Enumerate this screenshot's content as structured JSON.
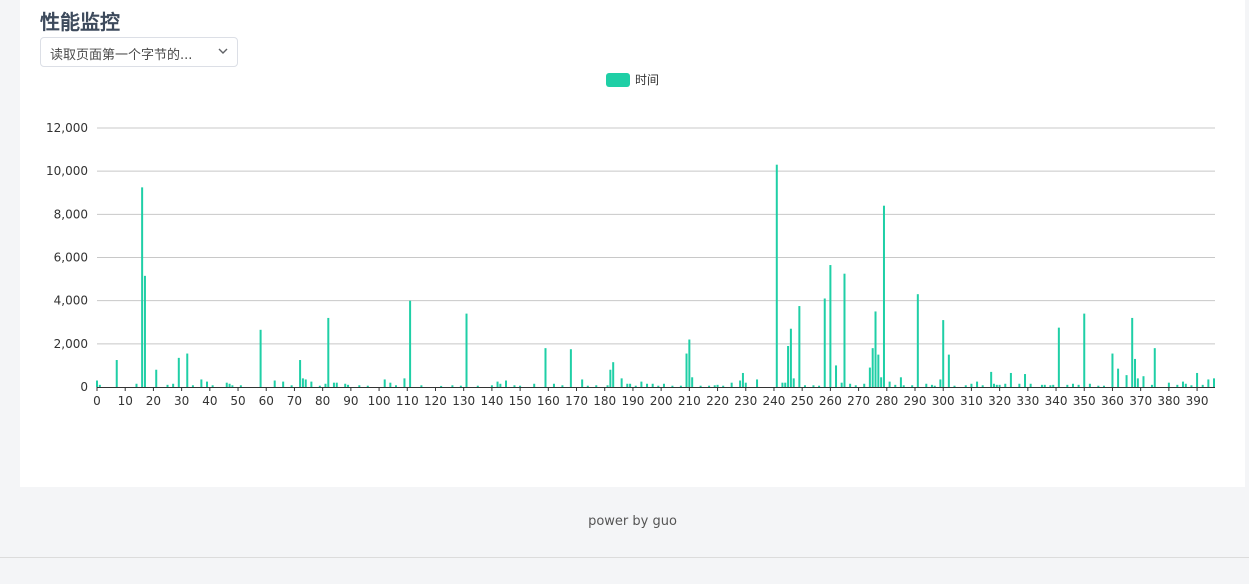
{
  "page": {
    "title": "性能监控",
    "metric_select": "读取页面第一个字节的...",
    "footer": "power by guo"
  },
  "colors": {
    "bar": "#1fcfa6",
    "grid": "#c8c8c8",
    "text": "#333333"
  },
  "icons": {
    "select_arrow": "chevron-down-icon"
  },
  "chart_data": {
    "type": "bar",
    "legend": [
      "时间"
    ],
    "legend_position": "top-center",
    "grid": true,
    "ylim": [
      0,
      12000
    ],
    "yticks": [
      "0",
      "2,000",
      "4,000",
      "6,000",
      "8,000",
      "10,000",
      "12,000"
    ],
    "ytick_values": [
      0,
      2000,
      4000,
      6000,
      8000,
      10000,
      12000
    ],
    "xticks": [
      "0",
      "10",
      "20",
      "30",
      "40",
      "50",
      "60",
      "70",
      "80",
      "90",
      "100",
      "110",
      "120",
      "130",
      "140",
      "150",
      "160",
      "170",
      "180",
      "190",
      "200",
      "210",
      "220",
      "230",
      "240",
      "250",
      "260",
      "270",
      "280",
      "290",
      "300",
      "310",
      "320",
      "330",
      "340",
      "350",
      "360",
      "370",
      "380",
      "390"
    ],
    "xtick_values": [
      0,
      10,
      20,
      30,
      40,
      50,
      60,
      70,
      80,
      90,
      100,
      110,
      120,
      130,
      140,
      150,
      160,
      170,
      180,
      190,
      200,
      210,
      220,
      230,
      240,
      250,
      260,
      270,
      280,
      290,
      300,
      310,
      320,
      330,
      340,
      350,
      360,
      370,
      380,
      390
    ],
    "x_count": 397,
    "series": [
      {
        "name": "时间",
        "points": [
          [
            0,
            300
          ],
          [
            1,
            100
          ],
          [
            7,
            1250
          ],
          [
            14,
            150
          ],
          [
            16,
            9250
          ],
          [
            17,
            5150
          ],
          [
            21,
            800
          ],
          [
            25,
            100
          ],
          [
            27,
            150
          ],
          [
            29,
            1350
          ],
          [
            32,
            1550
          ],
          [
            34,
            80
          ],
          [
            37,
            350
          ],
          [
            39,
            250
          ],
          [
            41,
            80
          ],
          [
            46,
            200
          ],
          [
            47,
            150
          ],
          [
            48,
            80
          ],
          [
            51,
            80
          ],
          [
            58,
            2650
          ],
          [
            63,
            300
          ],
          [
            66,
            250
          ],
          [
            69,
            80
          ],
          [
            72,
            1250
          ],
          [
            73,
            400
          ],
          [
            74,
            350
          ],
          [
            76,
            250
          ],
          [
            79,
            60
          ],
          [
            81,
            150
          ],
          [
            82,
            3200
          ],
          [
            84,
            200
          ],
          [
            85,
            200
          ],
          [
            88,
            150
          ],
          [
            89,
            100
          ],
          [
            93,
            80
          ],
          [
            96,
            60
          ],
          [
            102,
            350
          ],
          [
            104,
            200
          ],
          [
            106,
            80
          ],
          [
            109,
            400
          ],
          [
            111,
            4000
          ],
          [
            115,
            80
          ],
          [
            122,
            50
          ],
          [
            126,
            80
          ],
          [
            129,
            60
          ],
          [
            131,
            3400
          ],
          [
            135,
            60
          ],
          [
            140,
            80
          ],
          [
            142,
            250
          ],
          [
            143,
            150
          ],
          [
            145,
            300
          ],
          [
            148,
            80
          ],
          [
            150,
            60
          ],
          [
            155,
            150
          ],
          [
            159,
            1800
          ],
          [
            162,
            150
          ],
          [
            165,
            80
          ],
          [
            168,
            1750
          ],
          [
            172,
            350
          ],
          [
            174,
            60
          ],
          [
            177,
            80
          ],
          [
            181,
            80
          ],
          [
            182,
            800
          ],
          [
            183,
            1150
          ],
          [
            186,
            400
          ],
          [
            188,
            150
          ],
          [
            189,
            150
          ],
          [
            191,
            60
          ],
          [
            193,
            250
          ],
          [
            195,
            150
          ],
          [
            197,
            150
          ],
          [
            199,
            60
          ],
          [
            201,
            150
          ],
          [
            204,
            60
          ],
          [
            207,
            60
          ],
          [
            209,
            1550
          ],
          [
            210,
            2200
          ],
          [
            211,
            450
          ],
          [
            214,
            60
          ],
          [
            217,
            60
          ],
          [
            219,
            80
          ],
          [
            220,
            100
          ],
          [
            222,
            60
          ],
          [
            225,
            200
          ],
          [
            228,
            300
          ],
          [
            229,
            650
          ],
          [
            230,
            200
          ],
          [
            234,
            350
          ],
          [
            241,
            10300
          ],
          [
            243,
            200
          ],
          [
            244,
            200
          ],
          [
            245,
            1900
          ],
          [
            246,
            2700
          ],
          [
            247,
            400
          ],
          [
            249,
            3750
          ],
          [
            251,
            80
          ],
          [
            254,
            80
          ],
          [
            256,
            60
          ],
          [
            258,
            4100
          ],
          [
            260,
            5650
          ],
          [
            262,
            1000
          ],
          [
            264,
            200
          ],
          [
            265,
            5250
          ],
          [
            267,
            150
          ],
          [
            269,
            80
          ],
          [
            272,
            150
          ],
          [
            274,
            900
          ],
          [
            275,
            1800
          ],
          [
            276,
            3500
          ],
          [
            277,
            1500
          ],
          [
            278,
            450
          ],
          [
            279,
            8400
          ],
          [
            281,
            250
          ],
          [
            283,
            100
          ],
          [
            285,
            450
          ],
          [
            286,
            80
          ],
          [
            289,
            80
          ],
          [
            291,
            4300
          ],
          [
            294,
            150
          ],
          [
            296,
            100
          ],
          [
            297,
            60
          ],
          [
            299,
            350
          ],
          [
            300,
            3100
          ],
          [
            302,
            1500
          ],
          [
            304,
            60
          ],
          [
            308,
            80
          ],
          [
            310,
            150
          ],
          [
            312,
            250
          ],
          [
            314,
            80
          ],
          [
            317,
            700
          ],
          [
            318,
            150
          ],
          [
            319,
            100
          ],
          [
            320,
            100
          ],
          [
            322,
            150
          ],
          [
            324,
            650
          ],
          [
            327,
            150
          ],
          [
            329,
            600
          ],
          [
            331,
            150
          ],
          [
            335,
            100
          ],
          [
            336,
            100
          ],
          [
            338,
            80
          ],
          [
            339,
            100
          ],
          [
            341,
            2750
          ],
          [
            344,
            100
          ],
          [
            346,
            150
          ],
          [
            348,
            100
          ],
          [
            350,
            3400
          ],
          [
            352,
            150
          ],
          [
            355,
            60
          ],
          [
            357,
            60
          ],
          [
            360,
            1550
          ],
          [
            362,
            850
          ],
          [
            365,
            550
          ],
          [
            367,
            3200
          ],
          [
            368,
            1300
          ],
          [
            369,
            400
          ],
          [
            371,
            500
          ],
          [
            374,
            100
          ],
          [
            375,
            1800
          ],
          [
            380,
            200
          ],
          [
            383,
            100
          ],
          [
            385,
            250
          ],
          [
            386,
            150
          ],
          [
            388,
            80
          ],
          [
            390,
            650
          ],
          [
            392,
            100
          ],
          [
            394,
            350
          ],
          [
            396,
            400
          ]
        ]
      }
    ]
  }
}
